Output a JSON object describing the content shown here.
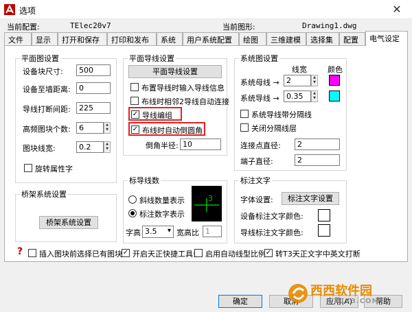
{
  "window": {
    "title": "选项",
    "current_profile_label": "当前配置:",
    "current_profile_value": "TElec20v7",
    "current_drawing_label": "当前图形:",
    "current_drawing_value": "Drawing1.dwg"
  },
  "tabs": [
    "文件",
    "显示",
    "打开和保存",
    "打印和发布",
    "系统",
    "用户系统配置",
    "绘图",
    "三维建模",
    "选择集",
    "配置",
    "电气设定"
  ],
  "plan_settings": {
    "title": "平面图设置",
    "block_size_label": "设备块尺寸:",
    "block_size_value": "500",
    "dist_label": "设备至墙距离:",
    "dist_value": "0",
    "break_label": "导线打断间距:",
    "break_value": "225",
    "hatch_label": "高频图块个数:",
    "hatch_value": "6",
    "linewidth_label": "图块线宽:",
    "linewidth_value": "0.2",
    "rotate_label": "旋转属性字"
  },
  "plan_wire": {
    "title": "平面导线设置",
    "button": "平面导线设置",
    "opt1": "布置导线时输入导线信息",
    "opt2": "布线时相邻2导线自动连接",
    "opt3": "导线编组",
    "opt4": "布线时自动倒圆角",
    "fillet_label": "倒角半径:",
    "fillet_value": "10"
  },
  "system_settings": {
    "title": "系统图设置",
    "col_width": "线宽",
    "col_color": "颜色",
    "bus_label": "系统母线 →",
    "bus_value": "2",
    "wire_label": "系统导线 →",
    "wire_value": "0.35",
    "sep_label": "系统导线带分隔线",
    "close_sep_label": "关闭分隔线层",
    "dot_label": "连接点直径:",
    "dot_value": "2",
    "terminal_label": "端子直径:",
    "terminal_value": "2"
  },
  "tray": {
    "title": "桥架系统设置",
    "button": "桥架系统设置"
  },
  "wire_count": {
    "title": "标导线数",
    "opt1": "斜线数量表示",
    "opt2": "标注数字表示",
    "font_height_label": "字高",
    "font_height_value": "3.5",
    "ratio_label": "宽高比",
    "ratio_value": "1",
    "preview_digit": "3"
  },
  "annotation": {
    "title": "标注文字",
    "font_label": "字体设置:",
    "font_button": "标注文字设置",
    "device_color_label": "设备标注文字颜色:",
    "wire_color_label": "导线标注文字颜色:"
  },
  "bottom": {
    "help": "?",
    "opt1": "插入图块前选择已有图块",
    "opt2": "开启天正快捷工具条",
    "opt3": "启用自动线型比例",
    "opt4": "转T3天正文字中英文打断"
  },
  "buttons": {
    "ok": "确定",
    "cancel": "取消",
    "apply": "应用(A)",
    "help": "帮助"
  },
  "watermark_text": "西西软件园",
  "watermark_url": "CR173.COM",
  "colors": {
    "bus_color": "#ff00ff",
    "wire_color": "#00ffff",
    "red_highlight": "#e02020",
    "preview_green": "#00c000"
  }
}
